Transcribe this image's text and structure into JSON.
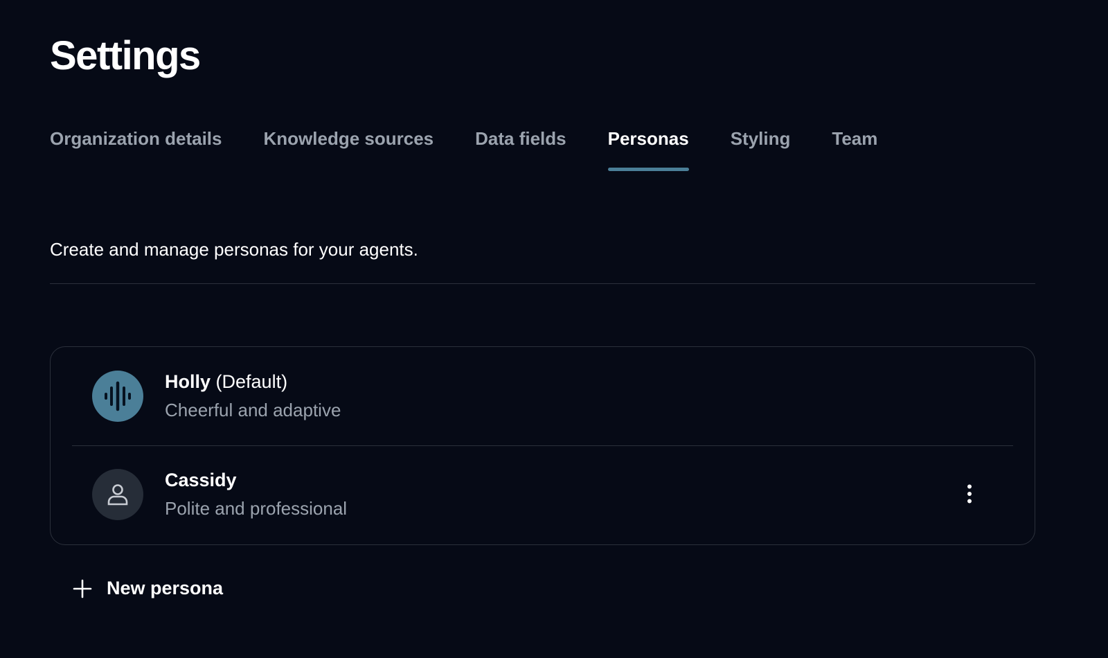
{
  "page": {
    "title": "Settings"
  },
  "tabs": [
    {
      "label": "Organization details",
      "active": false
    },
    {
      "label": "Knowledge sources",
      "active": false
    },
    {
      "label": "Data fields",
      "active": false
    },
    {
      "label": "Personas",
      "active": true
    },
    {
      "label": "Styling",
      "active": false
    },
    {
      "label": "Team",
      "active": false
    }
  ],
  "personas_section": {
    "description": "Create and manage personas for your agents.",
    "personas": [
      {
        "name": "Holly",
        "tag": "(Default)",
        "description": "Cheerful and adaptive",
        "avatar_icon": "waveform-icon",
        "avatar_color": "#4b7f98"
      },
      {
        "name": "Cassidy",
        "tag": "",
        "description": "Polite and professional",
        "avatar_icon": "person-icon",
        "avatar_color": "#262d38",
        "menu_icon": "more-vertical-icon"
      }
    ],
    "new_persona_label": "New persona",
    "new_persona_icon": "plus-icon"
  },
  "colors": {
    "background": "#060a16",
    "accent": "#4b7f98",
    "muted_text": "#9ba3ae",
    "border": "#2b303b"
  }
}
